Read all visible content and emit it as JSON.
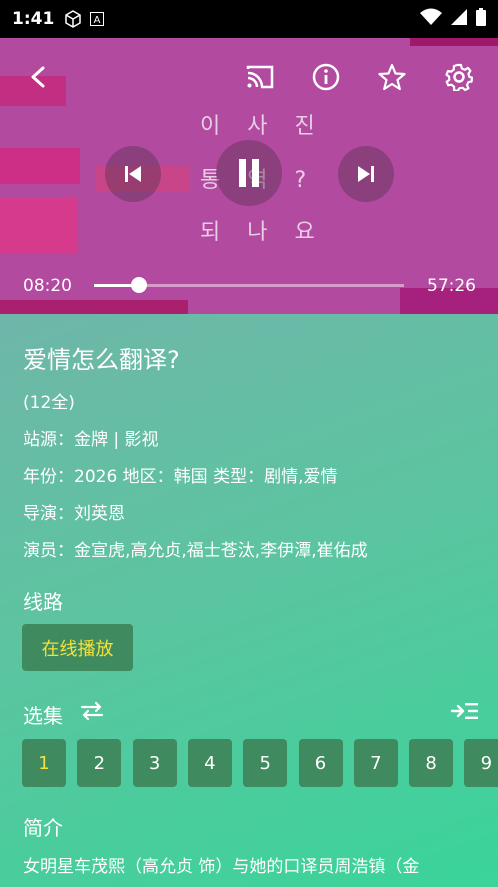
{
  "status_bar": {
    "time": "1:41"
  },
  "player": {
    "korean_overlay": [
      "이 사 진",
      "통 역 ?",
      "되 나 요"
    ],
    "current_time": "08:20",
    "total_time": "57:26",
    "progress": 0.145,
    "icons": {
      "back": "back-arrow-icon",
      "cast": "cast-icon",
      "info": "info-icon",
      "favorite": "star-icon",
      "settings": "gear-icon",
      "previous": "skip-previous-icon",
      "pause": "pause-icon",
      "next": "skip-next-icon"
    }
  },
  "details": {
    "title": "爱情怎么翻译?",
    "episodes_note": "(12全)",
    "source": "站源：金牌 | 影视",
    "meta": "年份：2026  地区：韩国  类型：剧情,爱情",
    "director": "导演：刘英恩",
    "cast": "演员：金宣虎,高允贞,福士苍汰,李伊潭,崔佑成"
  },
  "route": {
    "heading": "线路",
    "option": "在线播放"
  },
  "episodes": {
    "heading": "选集",
    "items": [
      "1",
      "2",
      "3",
      "4",
      "5",
      "6",
      "7",
      "8",
      "9"
    ],
    "selected": "1"
  },
  "synopsis": {
    "heading": "简介",
    "text": "女明星车茂熙（高允贞 饰）与她的口译员周浩镇（金"
  },
  "colors": {
    "accent": "#f3e23b",
    "button_bg": "#3f8a5f"
  }
}
